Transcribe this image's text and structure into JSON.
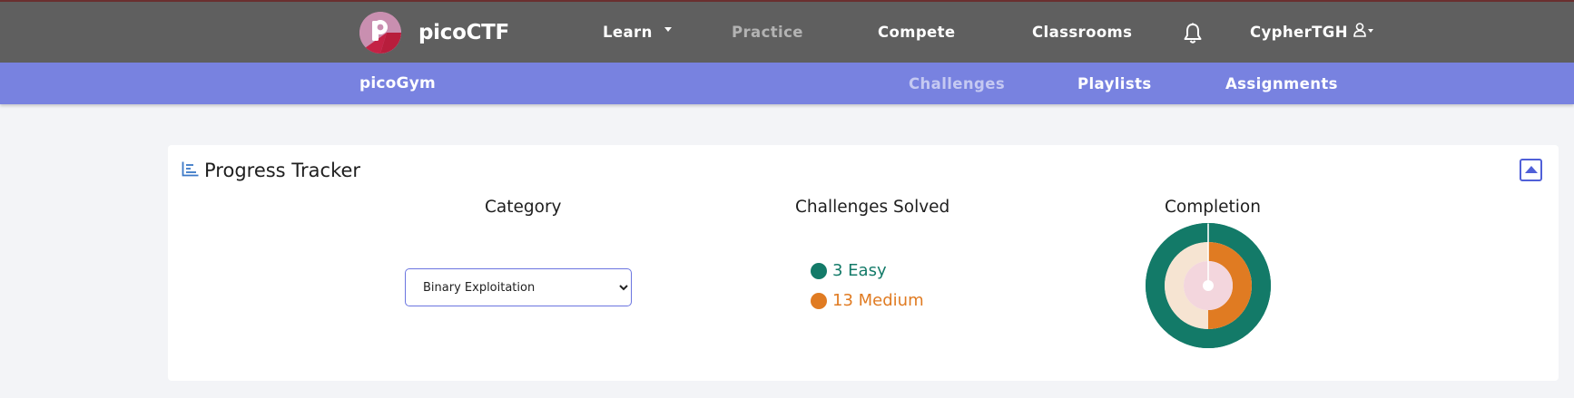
{
  "nav": {
    "brand": "picoCTF",
    "items": {
      "learn": "Learn",
      "practice": "Practice",
      "compete": "Compete",
      "classrooms": "Classrooms"
    },
    "username": "CypherTGH",
    "icons": [
      "picoctf-logo",
      "chevron-down-icon",
      "bell-icon",
      "user-icon"
    ]
  },
  "subnav": {
    "brand": "picoGym",
    "items": {
      "challenges": "Challenges",
      "playlists": "Playlists",
      "assignments": "Assignments"
    }
  },
  "progress": {
    "title": "Progress Tracker",
    "icons": [
      "bar-chart-icon",
      "collapse-up-icon"
    ],
    "category_heading": "Category",
    "solved_heading": "Challenges Solved",
    "completion_heading": "Completion",
    "category_selected": "Binary Exploitation",
    "solved": {
      "easy": {
        "text": "3 Easy",
        "count": 3,
        "color": "#137a68"
      },
      "medium": {
        "text": "13 Medium",
        "count": 13,
        "color": "#e07b22"
      }
    },
    "completion_fractions": {
      "easy": 1.0,
      "medium": 0.5,
      "hard": 0.0
    }
  },
  "colors": {
    "topbar": "#5f5f5f",
    "subbar": "#7882e0",
    "accent": "#5060d8",
    "easy": "#137a68",
    "easy_track": "#137a68",
    "medium": "#e07b22",
    "medium_track": "#f6e4d2",
    "hard_track": "#f3d6dd"
  }
}
